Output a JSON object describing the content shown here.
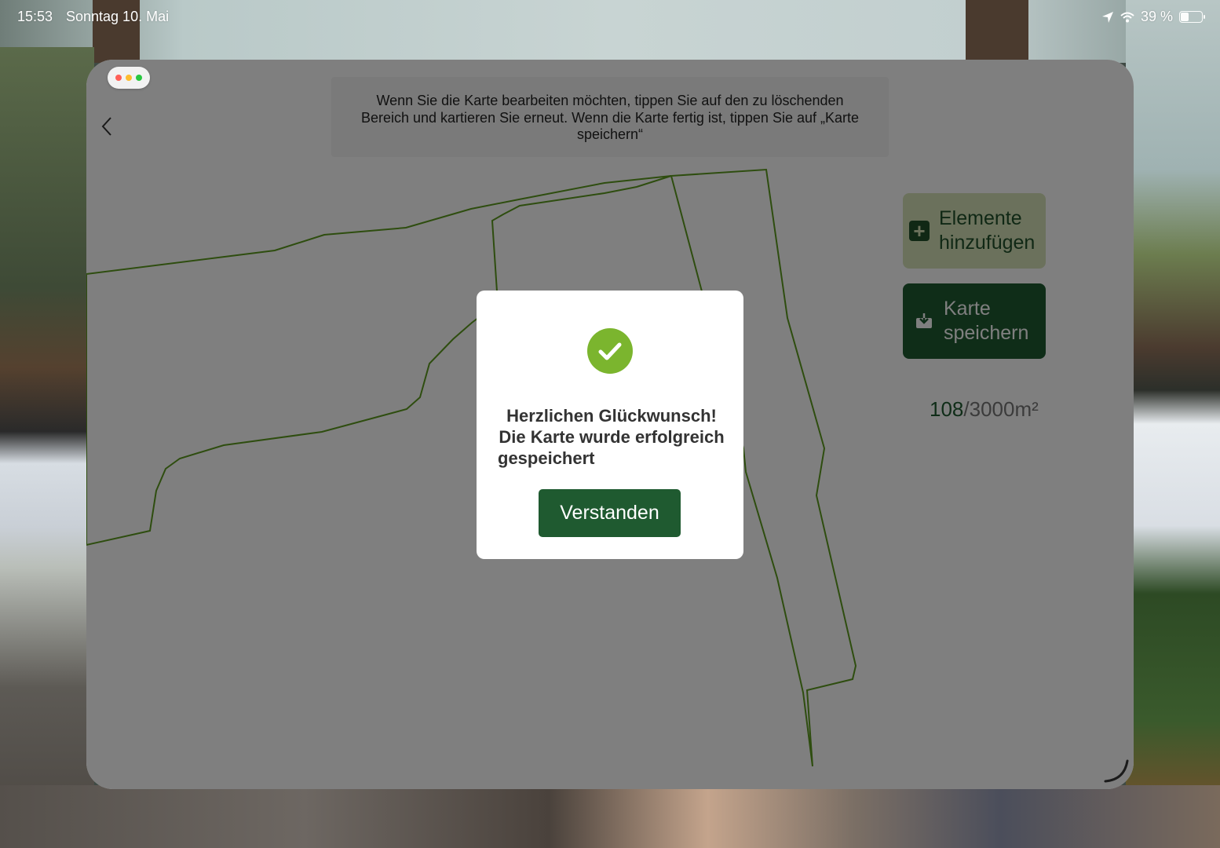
{
  "status_bar": {
    "time": "15:53",
    "date": "Sonntag 10. Mai",
    "battery": "39 %",
    "battery_level": 0.39
  },
  "window": {
    "instruction": "Wenn Sie die Karte bearbeiten möchten, tippen Sie auf den zu löschenden Bereich und kartieren Sie erneut. Wenn die Karte fertig ist, tippen Sie auf „Karte speichern“",
    "add_elements_label_1": "Elemente",
    "add_elements_label_2": "hinzufügen",
    "save_map_label_1": "Karte",
    "save_map_label_2": "speichern",
    "area_current": "108",
    "area_total": "/3000m²"
  },
  "modal": {
    "line1": "Herzlichen Glückwunsch!",
    "line2": "Die Karte wurde erfolgreich",
    "line3": "gespeichert",
    "button": "Verstanden"
  },
  "colors": {
    "brand_green": "#1f5a30",
    "light_green": "#d7e3b9",
    "success_green": "#7bb52e",
    "map_line": "#5c9a1e"
  }
}
